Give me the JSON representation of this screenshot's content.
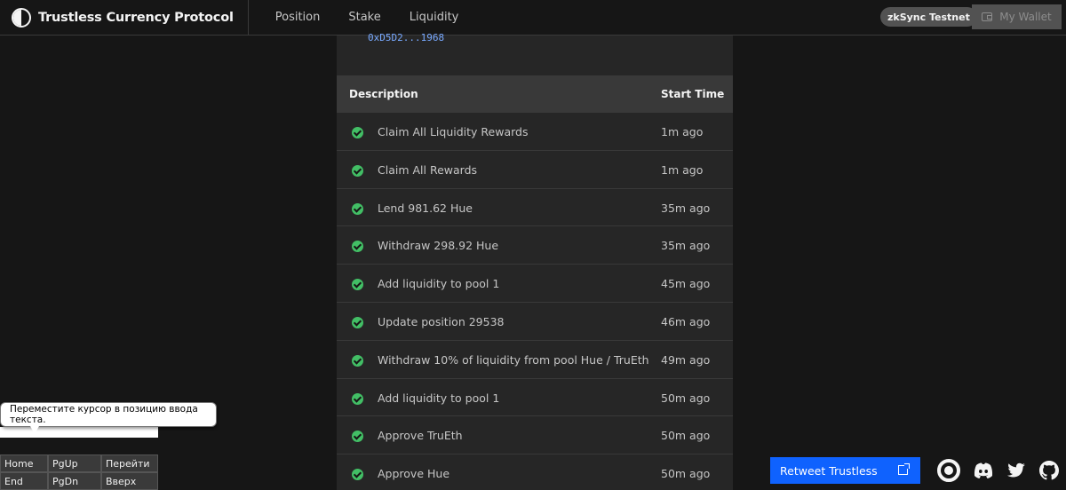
{
  "header": {
    "brand": "Trustless Currency Protocol",
    "nav": [
      "Position",
      "Stake",
      "Liquidity"
    ],
    "network": "zkSync Testnet",
    "wallet_label": "My Wallet"
  },
  "panel": {
    "address": "0xD5D2...1968",
    "columns": {
      "description": "Description",
      "start_time": "Start Time"
    },
    "rows": [
      {
        "description": "Claim All Liquidity Rewards",
        "time": "1m ago"
      },
      {
        "description": "Claim All Rewards",
        "time": "1m ago"
      },
      {
        "description": "Lend 981.62 Hue",
        "time": "35m ago"
      },
      {
        "description": "Withdraw 298.92 Hue",
        "time": "35m ago"
      },
      {
        "description": "Add liquidity to pool 1",
        "time": "45m ago"
      },
      {
        "description": "Update position 29538",
        "time": "46m ago"
      },
      {
        "description": "Withdraw 10% of liquidity from pool Hue / TruEth",
        "time": "49m ago"
      },
      {
        "description": "Add liquidity to pool 1",
        "time": "50m ago"
      },
      {
        "description": "Approve TruEth",
        "time": "50m ago"
      },
      {
        "description": "Approve Hue",
        "time": "50m ago"
      }
    ]
  },
  "overlay": {
    "tooltip": "Переместите курсор в позицию ввода текста.",
    "keys": [
      "Home",
      "PgUp",
      "Перейти",
      "End",
      "PgDn",
      "Вверх"
    ]
  },
  "footer": {
    "retweet_label": "Retweet Trustless",
    "social_icons": [
      "circle-logo-icon",
      "discord-icon",
      "twitter-icon",
      "github-icon"
    ]
  },
  "colors": {
    "background": "#161616",
    "panel": "#262626",
    "table_header": "#393939",
    "success": "#42be65",
    "primary": "#0f62fe",
    "address": "#78a9ff"
  }
}
